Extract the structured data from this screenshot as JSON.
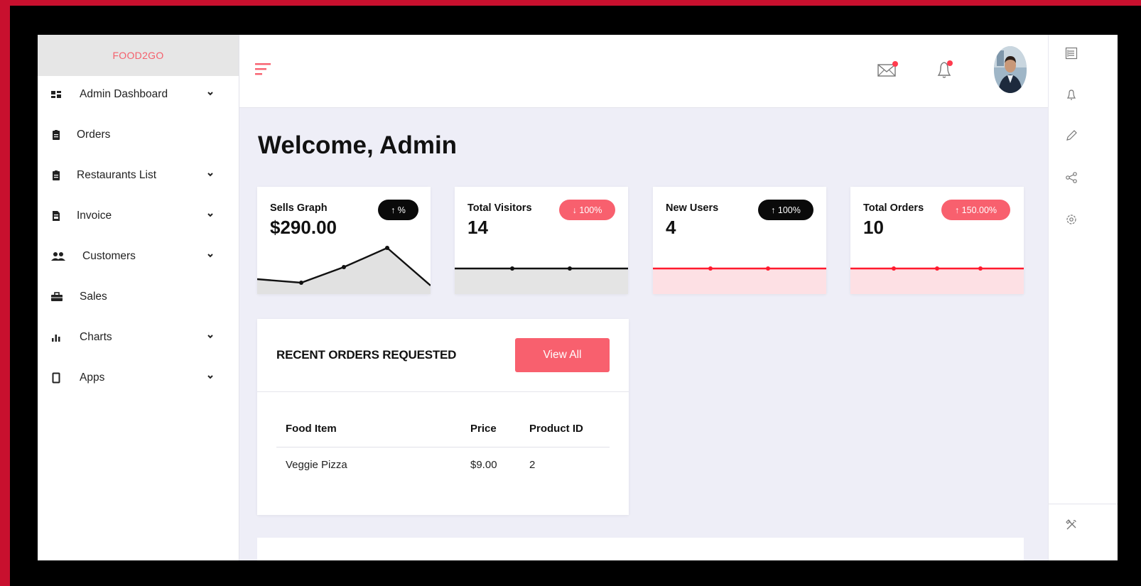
{
  "brand": "FOOD2GO",
  "sidebar": {
    "items": [
      {
        "label": "Admin Dashboard",
        "icon": "dashboard-icon",
        "has_chevron": true
      },
      {
        "label": "Orders",
        "icon": "clipboard-icon",
        "has_chevron": false
      },
      {
        "label": "Restaurants List",
        "icon": "clipboard-icon",
        "has_chevron": true
      },
      {
        "label": "Invoice",
        "icon": "document-icon",
        "has_chevron": true
      },
      {
        "label": "Customers",
        "icon": "users-icon",
        "has_chevron": true
      },
      {
        "label": "Sales",
        "icon": "briefcase-icon",
        "has_chevron": false
      },
      {
        "label": "Charts",
        "icon": "bar-chart-icon",
        "has_chevron": true
      },
      {
        "label": "Apps",
        "icon": "mobile-icon",
        "has_chevron": true
      }
    ]
  },
  "header": {
    "icons": [
      "menu-icon",
      "mail-icon",
      "bell-icon",
      "avatar"
    ]
  },
  "rail": {
    "icons": [
      "list-icon",
      "bell-icon",
      "pencil-icon",
      "share-icon",
      "settings-icon",
      "tools-icon"
    ]
  },
  "main": {
    "welcome": "Welcome, Admin",
    "stats": [
      {
        "title": "Sells Graph",
        "value": "$290.00",
        "badge": "↑ %",
        "badge_style": "dark"
      },
      {
        "title": "Total Visitors",
        "value": "14",
        "badge": "↓ 100%",
        "badge_style": "pink"
      },
      {
        "title": "New Users",
        "value": "4",
        "badge": "↑ 100%",
        "badge_style": "dark"
      },
      {
        "title": "Total Orders",
        "value": "10",
        "badge": "↑ 150.00%",
        "badge_style": "pink"
      }
    ],
    "recent_orders": {
      "title": "RECENT ORDERS REQUESTED",
      "button": "View All",
      "columns": [
        "Food Item",
        "Price",
        "Product ID"
      ],
      "rows": [
        [
          "Veggie Pizza",
          "$9.00",
          "2"
        ]
      ]
    }
  },
  "colors": {
    "accent": "#f8606e",
    "frame": "#c8102e",
    "background": "#eeeef7",
    "dark_badge": "#0a0a0a"
  }
}
